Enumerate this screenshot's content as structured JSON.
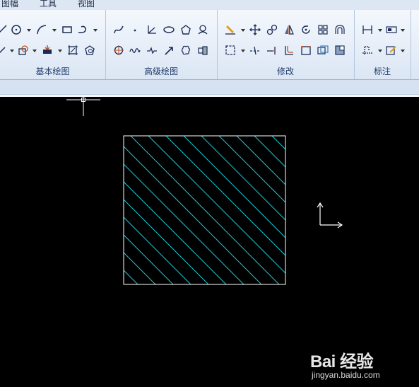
{
  "menu": {
    "items": [
      "图幅",
      "工具",
      "视图"
    ]
  },
  "ribbon": {
    "groups": [
      {
        "label": "基本绘图"
      },
      {
        "label": "高级绘图"
      },
      {
        "label": "修改"
      },
      {
        "label": "标注"
      }
    ]
  },
  "watermark": {
    "logo": "Bai 经验",
    "url": "jingyan.baidu.com"
  },
  "colors": {
    "hatch": "#19c9d4",
    "outline": "#ffffff",
    "background": "#000000"
  }
}
